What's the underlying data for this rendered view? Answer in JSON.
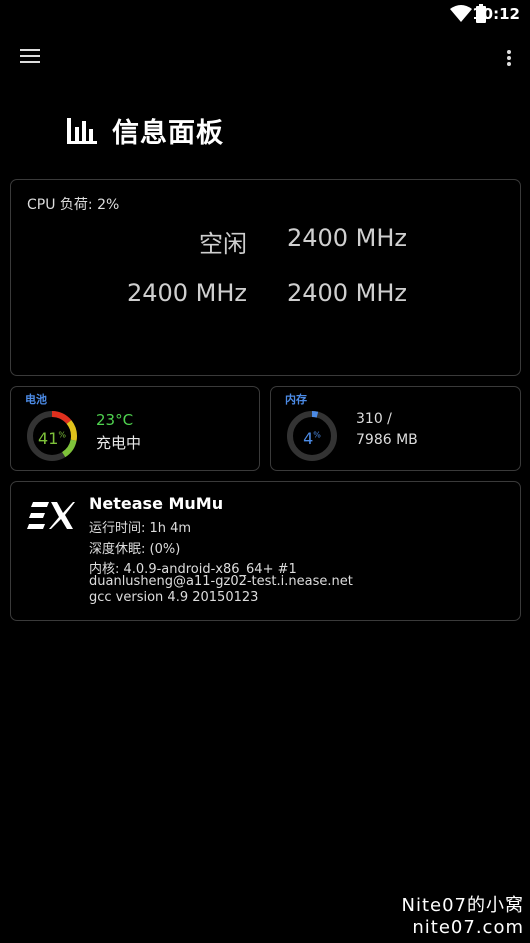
{
  "status_bar": {
    "time": "10:12"
  },
  "header": {
    "title": "信息面板"
  },
  "cpu": {
    "load_label": "CPU 负荷: 2%",
    "cores": [
      "空闲",
      "2400 MHz",
      "2400 MHz",
      "2400 MHz"
    ]
  },
  "battery": {
    "label": "电池",
    "percent": "41",
    "percent_unit": "%",
    "level": 0.41,
    "temperature": "23°C",
    "status": "充电中",
    "colors": {
      "track": "#333333",
      "green": "#7ec23a",
      "yellow": "#e0c21b",
      "red": "#e0301e",
      "temp": "#4fd24f"
    }
  },
  "memory": {
    "label": "内存",
    "percent": "4",
    "percent_unit": "%",
    "level": 0.04,
    "used": "310 /",
    "total": "7986 MB",
    "colors": {
      "track": "#333333",
      "fill": "#4c8be6"
    }
  },
  "system": {
    "name": "Netease MuMu",
    "uptime": "运行时间: 1h 4m",
    "deep_sleep": "深度休眠: (0%)",
    "kernel": "内核: 4.0.9-android-x86_64+ #1",
    "builder": "duanlusheng@a11-gz02-test.i.nease.net",
    "gcc": "gcc version 4.9 20150123"
  },
  "watermark": {
    "line1": "Nite07的小窝",
    "line2": "nite07.com"
  },
  "colors": {
    "accent": "#4c8be6",
    "card_border": "#3a3a3a",
    "background": "#000000"
  }
}
